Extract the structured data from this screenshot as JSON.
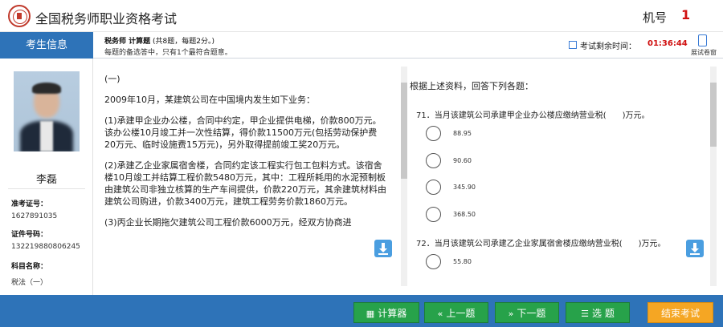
{
  "header": {
    "app_title": "全国税务师职业资格考试",
    "seat_label": "机号",
    "seat_value": "1"
  },
  "sidebar": {
    "tab_label": "考生信息",
    "candidate_name": "李磊",
    "fields": [
      {
        "label": "准考证号：",
        "value": "1627891035"
      },
      {
        "label": "证件号码：",
        "value": "132219880806245"
      },
      {
        "label": "科目名称：",
        "value": "税法（一）"
      }
    ]
  },
  "subbar": {
    "subject": "税务师 计算题",
    "subject_meta": "(共8题，每题2分。)",
    "hint": "每题的备选答中，只有1个最符合题意。",
    "timer_label": "考试剩余时间：",
    "timer_value": "01:36:44",
    "panel_toggle_label": "展试卷窗"
  },
  "material": {
    "paragraphs": [
      "(一)",
      "2009年10月，某建筑公司在中国境内发生如下业务：",
      "(1)承建甲企业办公楼，合同中约定，甲企业提供电梯，价款800万元。该办公楼10月竣工并一次性结算，得价款11500万元(包括劳动保护费20万元、临时设施费15万元)，另外取得提前竣工奖20万元。",
      "(2)承建乙企业家属宿舍楼，合同约定该工程实行包工包料方式。该宿舍楼10月竣工并结算工程价款5480万元，其中：工程所耗用的水泥预制板由建筑公司非独立核算的生产车间提供，价款220万元，其余建筑材料由建筑公司购进，价款3400万元，建筑工程劳务价款1860万元。",
      "(3)丙企业长期拖欠建筑公司工程价款6000万元，经双方协商进"
    ]
  },
  "question": {
    "intro": "根据上述资料，回答下列各题：",
    "items": [
      {
        "stem": "71．当月该建筑公司承建甲企业办公楼应缴纳营业税(　　)万元。",
        "options": [
          "88.95",
          "90.60",
          "345.90",
          "368.50"
        ]
      },
      {
        "stem": "72．当月该建筑公司承建乙企业家属宿舍楼应缴纳营业税(　　)万元。",
        "options": [
          "55.80"
        ]
      }
    ]
  },
  "footer": {
    "calculator": "计算器",
    "prev": "上一题",
    "next": "下一题",
    "select": "选 题",
    "end": "结束考试"
  },
  "colors": {
    "brand_blue": "#2e73b8",
    "button_green": "#27a24a",
    "end_orange": "#f5a623",
    "alert_red": "#d01010"
  }
}
